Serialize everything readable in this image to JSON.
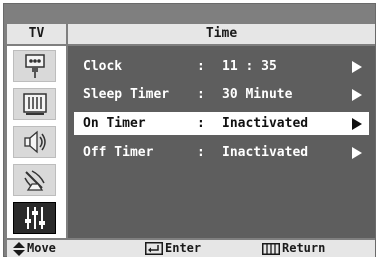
{
  "header": {
    "tv_label": "TV",
    "title": "Time"
  },
  "sidebar": {
    "items": [
      {
        "icon": "input-plug-icon",
        "active": false
      },
      {
        "icon": "picture-icon",
        "active": false
      },
      {
        "icon": "sound-speaker-icon",
        "active": false
      },
      {
        "icon": "channel-antenna-icon",
        "active": false
      },
      {
        "icon": "setup-sliders-icon",
        "active": true
      }
    ]
  },
  "menu": {
    "rows": [
      {
        "label": "Clock",
        "sep": ":",
        "value": "11 : 35",
        "selected": false
      },
      {
        "label": "Sleep Timer",
        "sep": ":",
        "value": "30 Minute",
        "selected": false
      },
      {
        "label": "On Timer",
        "sep": ":",
        "value": "Inactivated",
        "selected": true
      },
      {
        "label": "Off Timer",
        "sep": ":",
        "value": "Inactivated",
        "selected": false
      }
    ]
  },
  "footer": {
    "move": "Move",
    "enter": "Enter",
    "return": "Return"
  }
}
